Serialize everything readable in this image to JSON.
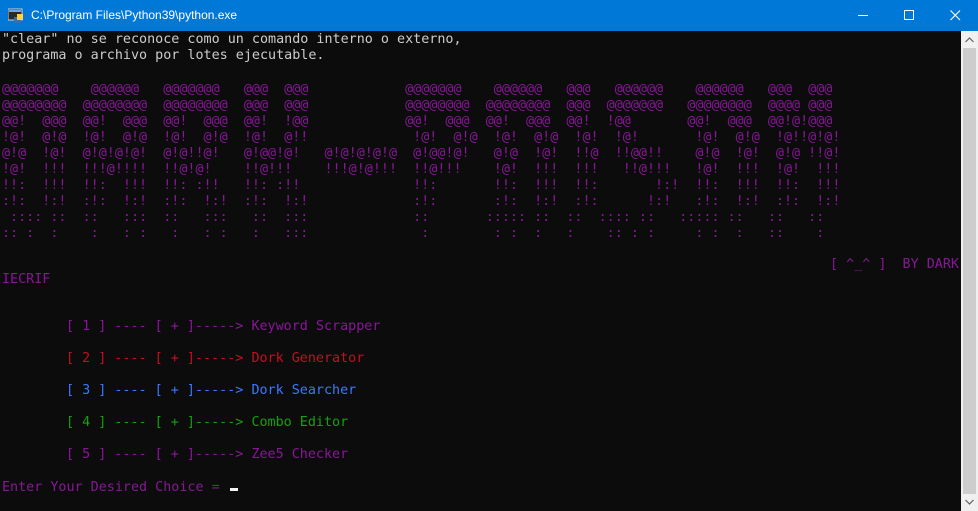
{
  "window": {
    "title": "C:\\Program Files\\Python39\\python.exe",
    "colors": {
      "titlebar": "#0078d7",
      "background": "#0c0c0c"
    }
  },
  "console": {
    "error_lines": [
      "\"clear\" no se reconoce como un comando interno o externo,",
      "programa o archivo por lotes ejecutable."
    ],
    "banner_lines": [
      "@@@@@@@    @@@@@@   @@@@@@@   @@@  @@@            @@@@@@@    @@@@@@   @@@   @@@@@@    @@@@@@   @@@  @@@",
      "@@@@@@@@  @@@@@@@@  @@@@@@@@  @@@  @@@            @@@@@@@@  @@@@@@@@  @@@  @@@@@@@   @@@@@@@@  @@@@ @@@",
      "@@!  @@@  @@!  @@@  @@!  @@@  @@!  !@@            @@!  @@@  @@!  @@@  @@!  !@@       @@!  @@@  @@!@!@@@",
      "!@!  @!@  !@!  @!@  !@!  @!@  !@!  @!!             !@!  @!@  !@!  @!@  !@!  !@!       !@!  @!@  !@!!@!@!",
      "@!@  !@!  @!@!@!@!  @!@!!@!   @!@@!@!   @!@!@!@!@  @!@@!@!   @!@  !@!  !!@  !!@@!!    @!@  !@!  @!@ !!@!",
      "!@!  !!!  !!!@!!!!  !!@!@!    !!@!!!    !!!@!@!!!  !!@!!!    !@!  !!!  !!!   !!@!!!   !@!  !!!  !@!  !!!",
      "!!:  !!!  !!:  !!!  !!: :!!   !!: :!!              !!:       !!:  !!!  !!:       !:!  !!:  !!!  !!:  !!!",
      ":!:  !:!  :!:  !:!  :!:  !:!  :!:  !:!             :!:       :!:  !:!  :!:      !:!   :!:  !:!  :!:  !:!",
      " :::: ::  ::   :::  ::   :::   ::  :::             ::       ::::: ::  ::  :::: ::   ::::: ::   ::   ::",
      ":: :  :    :   : :   :   : :   :   :::              :        : :  :   :    :: : :     : :  :   ::    :"
    ],
    "byline": "[ ^_^ ]  BY DARK",
    "byline_cont": "IECRIF",
    "menu": [
      {
        "prefix": "[ 1 ] ---- [ + ]-----> ",
        "name": "Keyword Scrapper",
        "color": "#881798"
      },
      {
        "prefix": "[ 2 ] ---- [ + ]-----> ",
        "name": "Dork Generator",
        "color": "#c50f1f"
      },
      {
        "prefix": "[ 3 ] ---- [ + ]-----> ",
        "name": "Dork Searcher",
        "color": "#3b78ff"
      },
      {
        "prefix": "[ 4 ] ---- [ + ]-----> ",
        "name": "Combo Editor",
        "color": "#13a10e"
      },
      {
        "prefix": "[ 5 ] ---- [ + ]-----> ",
        "name": "Zee5 Checker",
        "color": "#881798"
      }
    ],
    "prompt": "Enter Your Desired Choice = ",
    "colors": {
      "text": "#cccccc",
      "banner": "#881798"
    }
  }
}
